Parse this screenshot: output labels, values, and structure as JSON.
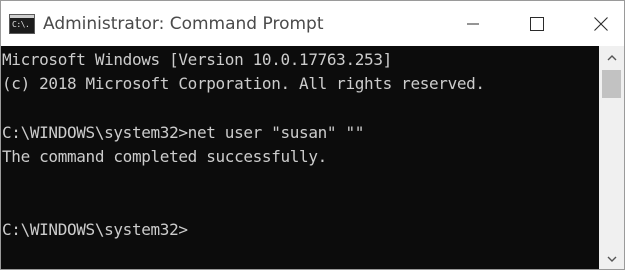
{
  "window": {
    "title": "Administrator: Command Prompt",
    "icon": "command-prompt-icon",
    "icon_text": "C:\\.",
    "controls": [
      "minimize-icon",
      "maximize-icon",
      "close-icon"
    ]
  },
  "console": {
    "background": "#0c0c0c",
    "foreground": "#cccccc",
    "lines": [
      "Microsoft Windows [Version 10.0.17763.253]",
      "(c) 2018 Microsoft Corporation. All rights reserved.",
      "",
      "C:\\WINDOWS\\system32>net user \"susan\" \"\"",
      "The command completed successfully.",
      "",
      "",
      "C:\\WINDOWS\\system32>"
    ]
  },
  "scrollbar": {
    "up_icon": "scroll-up-arrow-icon",
    "down_icon": "scroll-down-arrow-icon"
  }
}
